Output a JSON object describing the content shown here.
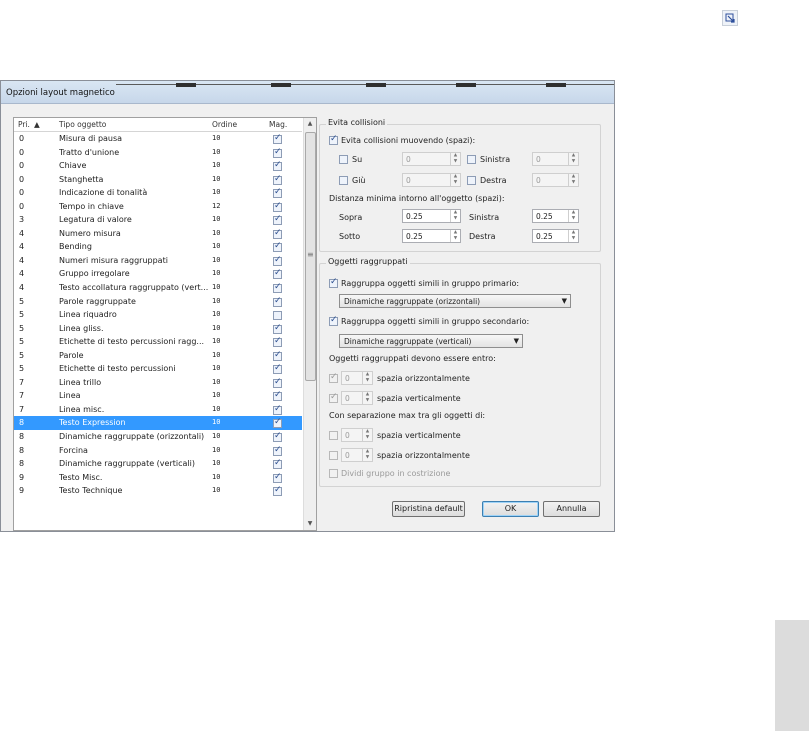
{
  "dialog": {
    "title": "Opzioni layout magnetico",
    "list": {
      "headers": {
        "pri": "Pri.",
        "tipo": "Tipo oggetto",
        "ordine": "Ordine",
        "mag": "Mag."
      },
      "rows": [
        {
          "pri": "0",
          "tipo": "Misura di pausa",
          "ordine": "10",
          "mag": true
        },
        {
          "pri": "0",
          "tipo": "Tratto d'unione",
          "ordine": "10",
          "mag": true
        },
        {
          "pri": "0",
          "tipo": "Chiave",
          "ordine": "10",
          "mag": true
        },
        {
          "pri": "0",
          "tipo": "Stanghetta",
          "ordine": "10",
          "mag": true
        },
        {
          "pri": "0",
          "tipo": "Indicazione di tonalità",
          "ordine": "10",
          "mag": true
        },
        {
          "pri": "0",
          "tipo": "Tempo in chiave",
          "ordine": "12",
          "mag": true
        },
        {
          "pri": "3",
          "tipo": "Legatura di valore",
          "ordine": "10",
          "mag": true
        },
        {
          "pri": "4",
          "tipo": "Numero misura",
          "ordine": "10",
          "mag": true
        },
        {
          "pri": "4",
          "tipo": "Bending",
          "ordine": "10",
          "mag": true
        },
        {
          "pri": "4",
          "tipo": "Numeri misura raggruppati",
          "ordine": "10",
          "mag": true
        },
        {
          "pri": "4",
          "tipo": "Gruppo irregolare",
          "ordine": "10",
          "mag": true
        },
        {
          "pri": "4",
          "tipo": "Testo accollatura raggruppato (vert...",
          "ordine": "10",
          "mag": true
        },
        {
          "pri": "5",
          "tipo": "Parole raggruppate",
          "ordine": "10",
          "mag": true
        },
        {
          "pri": "5",
          "tipo": "Linea riquadro",
          "ordine": "10",
          "mag": false
        },
        {
          "pri": "5",
          "tipo": "Linea gliss.",
          "ordine": "10",
          "mag": true
        },
        {
          "pri": "5",
          "tipo": "Etichette di testo percussioni ragg...",
          "ordine": "10",
          "mag": true
        },
        {
          "pri": "5",
          "tipo": "Parole",
          "ordine": "10",
          "mag": true
        },
        {
          "pri": "5",
          "tipo": "Etichette di testo percussioni",
          "ordine": "10",
          "mag": true
        },
        {
          "pri": "7",
          "tipo": "Linea trillo",
          "ordine": "10",
          "mag": true
        },
        {
          "pri": "7",
          "tipo": "Linea",
          "ordine": "10",
          "mag": true
        },
        {
          "pri": "7",
          "tipo": "Linea misc.",
          "ordine": "10",
          "mag": true
        },
        {
          "pri": "8",
          "tipo": "Testo Expression",
          "ordine": "10",
          "mag": true,
          "selected": true
        },
        {
          "pri": "8",
          "tipo": "Dinamiche raggruppate (orizzontali)",
          "ordine": "10",
          "mag": true
        },
        {
          "pri": "8",
          "tipo": "Forcina",
          "ordine": "10",
          "mag": true
        },
        {
          "pri": "8",
          "tipo": "Dinamiche raggruppate (verticali)",
          "ordine": "10",
          "mag": true
        },
        {
          "pri": "9",
          "tipo": "Testo Misc.",
          "ordine": "10",
          "mag": true
        },
        {
          "pri": "9",
          "tipo": "Testo Technique",
          "ordine": "10",
          "mag": true
        }
      ]
    },
    "evita": {
      "legend": "Evita collisioni",
      "main_check": "Evita collisioni muovendo (spazi):",
      "main_checked": true,
      "su": {
        "label": "Su",
        "value": "0"
      },
      "giu": {
        "label": "Giù",
        "value": "0"
      },
      "sinistra": {
        "label": "Sinistra",
        "value": "0"
      },
      "destra": {
        "label": "Destra",
        "value": "0"
      },
      "distanza_label": "Distanza minima intorno all'oggetto (spazi):",
      "sopra": {
        "label": "Sopra",
        "value": "0.25"
      },
      "sotto": {
        "label": "Sotto",
        "value": "0.25"
      },
      "dist_sinistra": {
        "label": "Sinistra",
        "value": "0.25"
      },
      "dist_destra": {
        "label": "Destra",
        "value": "0.25"
      }
    },
    "oggetti": {
      "legend": "Oggetti raggruppati",
      "primario_check": "Raggruppa oggetti simili in gruppo primario:",
      "primario_value": "Dinamiche raggruppate (orizzontali)",
      "secondario_check": "Raggruppa oggetti simili in gruppo secondario:",
      "secondario_value": "Dinamiche raggruppate (verticali)",
      "entro_label": "Oggetti raggruppati devono essere entro:",
      "entro_oriz": {
        "value": "0",
        "label": "spazia orizzontalmente"
      },
      "entro_vert": {
        "value": "0",
        "label": "spazia verticalmente"
      },
      "sep_label": "Con separazione max tra gli oggetti di:",
      "sep_vert": {
        "value": "0",
        "label": "spazia verticalmente"
      },
      "sep_oriz": {
        "value": "0",
        "label": "spazia orizzontalmente"
      },
      "dividi": "Dividi gruppo in costrizione"
    },
    "buttons": {
      "reset": "Ripristina default",
      "ok": "OK",
      "cancel": "Annulla"
    }
  },
  "colors": {
    "selection": "#3399ff",
    "dialog_bg": "#f0f0f0"
  }
}
